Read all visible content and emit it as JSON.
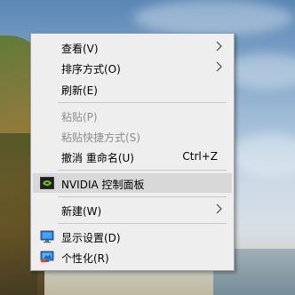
{
  "menu": {
    "items": [
      {
        "label": "查看(V)",
        "has_submenu": true
      },
      {
        "label": "排序方式(O)",
        "has_submenu": true
      },
      {
        "label": "刷新(E)"
      },
      {
        "label": "粘贴(P)",
        "disabled": true
      },
      {
        "label": "粘贴快捷方式(S)",
        "disabled": true
      },
      {
        "label": "撤消 重命名(U)",
        "shortcut": "Ctrl+Z"
      },
      {
        "label": "NVIDIA 控制面板",
        "icon": "nvidia-icon",
        "highlighted": true
      },
      {
        "label": "新建(W)",
        "has_submenu": true
      },
      {
        "label": "显示设置(D)",
        "icon": "display-settings-icon"
      },
      {
        "label": "个性化(R)",
        "icon": "personalize-icon"
      }
    ]
  },
  "colors": {
    "menu_background": "#eeeeee",
    "highlight": "#d8d8d8",
    "disabled_text": "#8d8d8d",
    "nvidia_green": "#76b900"
  }
}
